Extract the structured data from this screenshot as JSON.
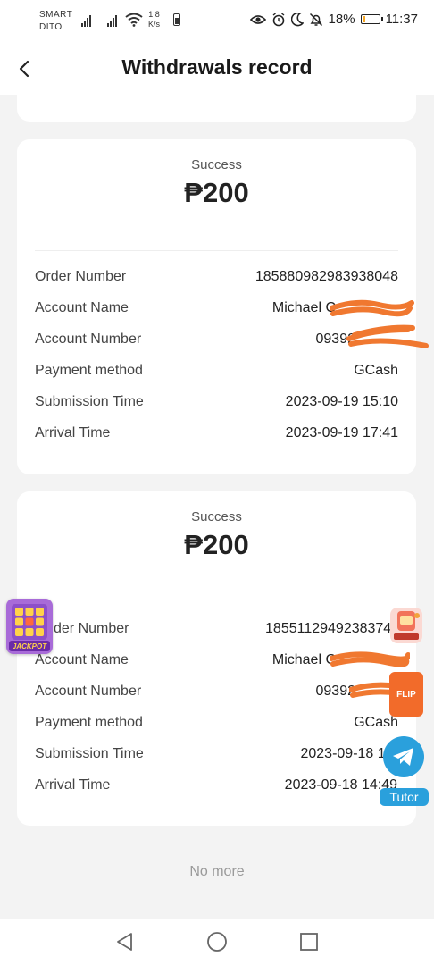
{
  "status_bar": {
    "carrier_line1": "SMART",
    "carrier_line2": "DITO",
    "speed_value": "1.8",
    "speed_unit": "K/s",
    "battery_percent": "18%",
    "time": "11:37"
  },
  "header": {
    "title": "Withdrawals record"
  },
  "records": [
    {
      "status": "Success",
      "amount": "₱200",
      "rows": [
        {
          "label": "Order Number",
          "value": "185880982983938048"
        },
        {
          "label": "Account Name",
          "value": "Michael C"
        },
        {
          "label": "Account Number",
          "value": "09392"
        },
        {
          "label": "Payment method",
          "value": "GCash"
        },
        {
          "label": "Submission Time",
          "value": "2023-09-19 15:10"
        },
        {
          "label": "Arrival Time",
          "value": "2023-09-19 17:41"
        }
      ]
    },
    {
      "status": "Success",
      "amount": "₱200",
      "rows": [
        {
          "label": "der Number",
          "value": "185511294923837440"
        },
        {
          "label": "Account Name",
          "value": "Michael C"
        },
        {
          "label": "Account Number",
          "value": "09392"
        },
        {
          "label": "Payment method",
          "value": "GCash"
        },
        {
          "label": "Submission Time",
          "value": "2023-09-18 14:"
        },
        {
          "label": "Arrival Time",
          "value": "2023-09-18 14:49"
        }
      ]
    }
  ],
  "footer": {
    "no_more": "No more"
  },
  "floating": {
    "jackpot_label": "JACKPOT",
    "flip_label": "FLIP",
    "tutor_label": "Tutor"
  },
  "colors": {
    "accent_orange": "#f26b2a",
    "telegram_blue": "#2aa0dc",
    "page_bg": "#f3f3f3"
  },
  "icons": {
    "back": "chevron-left-icon",
    "telegram": "telegram-icon",
    "nav_back": "triangle-back-icon",
    "nav_home": "circle-home-icon",
    "nav_recents": "square-recents-icon"
  }
}
